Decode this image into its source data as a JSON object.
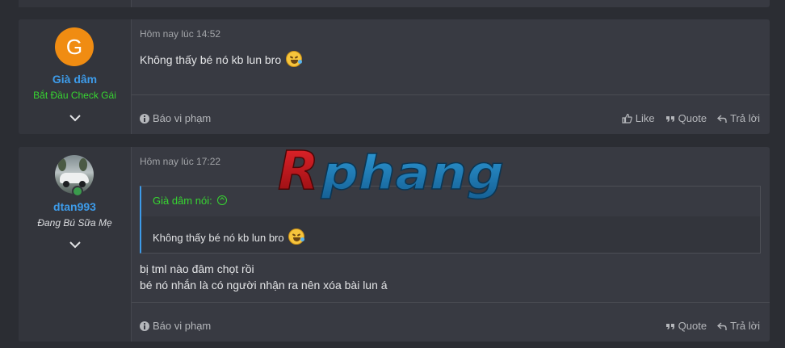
{
  "posts": [
    {
      "avatar_letter": "G",
      "username": "Già dâm",
      "user_title": "Bắt Đầu Check Gái",
      "date": "Hôm nay lúc 14:52",
      "message": "Không thấy bé nó kb lun bro",
      "report_label": "Báo vi phạm",
      "like_label": "Like",
      "quote_label": "Quote",
      "reply_label": "Trả lời"
    },
    {
      "username": "dtan993",
      "user_title": "Đang Bú Sữa Mẹ",
      "date": "Hôm nay lúc 17:22",
      "quote_author": "Già dâm nói:",
      "quote_text": "Không thấy bé nó kb lun bro",
      "message_line1": "bị tml nào đâm chọt rồi",
      "message_line2": "bé nó nhắn là có người nhận ra nên xóa bài lun á",
      "report_label": "Báo vi phạm",
      "quote_label": "Quote",
      "reply_label": "Trả lời"
    }
  ],
  "watermark": "Rphang",
  "colors": {
    "page_bg": "#2b2d33",
    "post_bg": "#383a42",
    "username": "#3d9be9",
    "title_green": "#37d631",
    "avatar_orange": "#f08c12",
    "watermark_red": "#c8141a",
    "watermark_blue": "#1f7fbf"
  },
  "icons": [
    "chevron-down-icon",
    "info-icon",
    "thumbs-up-icon",
    "quote-icon",
    "reply-icon",
    "arrow-up-circle-icon",
    "laughing-emoji-icon",
    "online-status-icon"
  ]
}
